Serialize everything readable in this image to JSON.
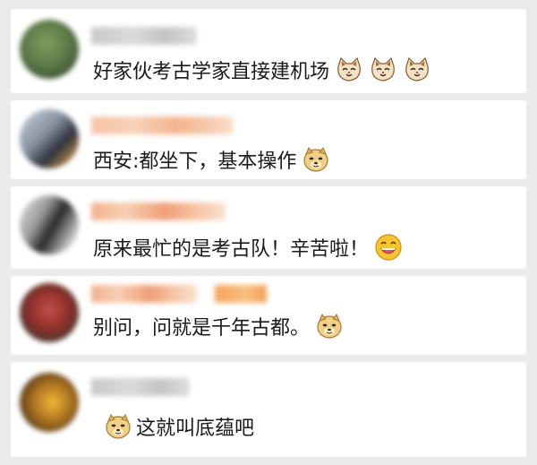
{
  "comments": [
    {
      "text": "好家伙考古学家直接建机场",
      "emojis": [
        "cat-face-emoji",
        "cat-face-emoji",
        "cat-face-emoji"
      ]
    },
    {
      "text": "西安:都坐下，基本操作",
      "emojis": [
        "doge-emoji"
      ]
    },
    {
      "text": "原来最忙的是考古队！辛苦啦！",
      "emojis": [
        "laughing-face-emoji"
      ]
    },
    {
      "text": "别问，问就是千年古都。",
      "emojis": [
        "doge-emoji"
      ]
    },
    {
      "text": "这就叫底蕴吧",
      "emojis": [
        "doge-emoji"
      ]
    }
  ]
}
